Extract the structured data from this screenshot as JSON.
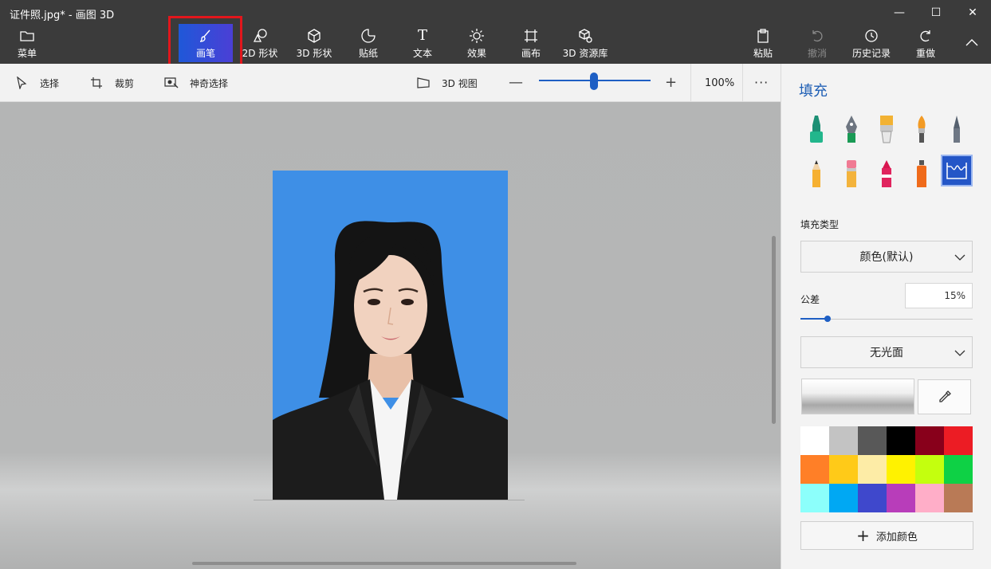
{
  "window": {
    "title": "证件照.jpg* - 画图 3D",
    "minimize": "—",
    "maximize": "☐",
    "close": "✕"
  },
  "ribbon": {
    "menu": "菜单",
    "brushes": "画笔",
    "shapes2d": "2D 形状",
    "shapes3d": "3D 形状",
    "stickers": "贴纸",
    "text": "文本",
    "effects": "效果",
    "canvas": "画布",
    "library3d": "3D 资源库",
    "paste": "粘贴",
    "undo": "撤消",
    "history": "历史记录",
    "redo": "重做"
  },
  "toolbar": {
    "select": "选择",
    "crop": "裁剪",
    "magic_select": "神奇选择",
    "view3d": "3D 视图",
    "zoom_minus": "—",
    "zoom_plus": "+",
    "zoom_value": "100%",
    "zoom_level_percent": 100,
    "more": "···"
  },
  "panel": {
    "title": "填充",
    "fill_type_label": "填充类型",
    "fill_type_value": "颜色(默认)",
    "tolerance_label": "公差",
    "tolerance_value": "15%",
    "tolerance_percent": 15,
    "finish_value": "无光面",
    "add_color": "添加颜色",
    "brushes": [
      "marker",
      "calligraphy-pen",
      "oil-brush",
      "watercolor",
      "pixel-pen",
      "pencil",
      "eraser",
      "crayon",
      "spray-can",
      "fill"
    ],
    "selected_brush": "fill",
    "palette": [
      "#ffffff",
      "#c3c3c3",
      "#585858",
      "#000000",
      "#88001b",
      "#ec1c24",
      "#ff7f27",
      "#ffca18",
      "#fdeca6",
      "#fff200",
      "#c4ff0e",
      "#0ed145",
      "#8cfffb",
      "#00a8f3",
      "#3f48cc",
      "#b83dba",
      "#ffaec8",
      "#b97a56"
    ]
  }
}
